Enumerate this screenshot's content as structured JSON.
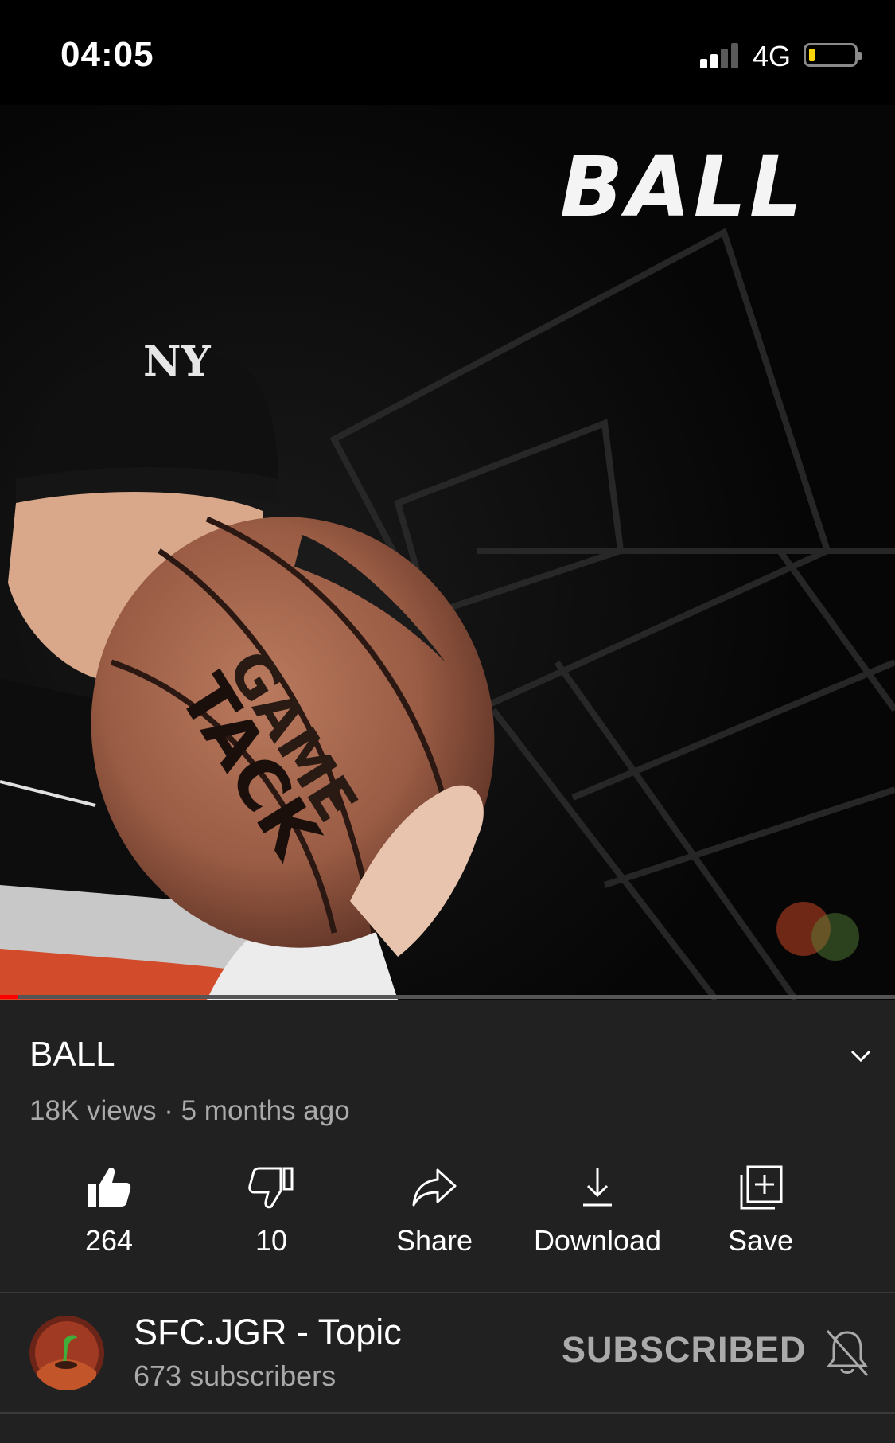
{
  "status_bar": {
    "time": "04:05",
    "network": "4G",
    "signal_bars_filled": 2,
    "signal_bars_total": 4,
    "battery_level": 0.12,
    "battery_color": "#ffd60a"
  },
  "video": {
    "overlay_title": "BALL",
    "progress_fraction": 0.02,
    "progress_color": "#ff0000"
  },
  "info": {
    "title": "BALL",
    "meta": "18K views · 5 months ago"
  },
  "actions": [
    {
      "label": "264",
      "icon": "thumbs-up-icon"
    },
    {
      "label": "10",
      "icon": "thumbs-down-icon"
    },
    {
      "label": "Share",
      "icon": "share-icon"
    },
    {
      "label": "Download",
      "icon": "download-icon"
    },
    {
      "label": "Save",
      "icon": "save-to-playlist-icon"
    }
  ],
  "channel": {
    "name": "SFC.JGR - Topic",
    "subscribers": "673 subscribers",
    "subscribe_label": "SUBSCRIBED"
  }
}
